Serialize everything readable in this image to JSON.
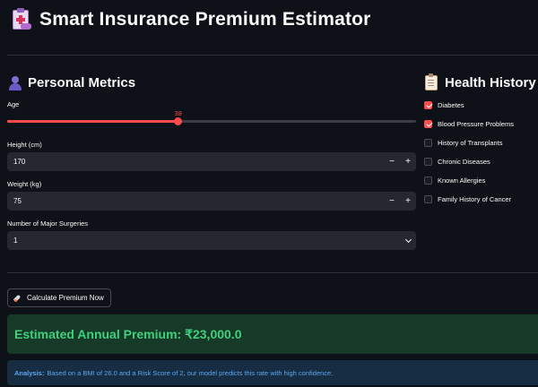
{
  "header": {
    "title": "Smart Insurance Premium Estimator",
    "icon": "clipboard-medical-icon"
  },
  "personal": {
    "heading": "Personal Metrics",
    "icon": "person-icon",
    "age": {
      "label": "Age",
      "value": "38",
      "fraction": 0.418
    },
    "height": {
      "label": "Height (cm)",
      "value": "170"
    },
    "weight": {
      "label": "Weight (kg)",
      "value": "75"
    },
    "surgeries": {
      "label": "Number of Major Surgeries",
      "value": "1"
    }
  },
  "health": {
    "heading": "Health History",
    "icon": "clipboard-icon",
    "items": [
      {
        "label": "Diabetes",
        "checked": true
      },
      {
        "label": "Blood Pressure Problems",
        "checked": true
      },
      {
        "label": "History of Transplants",
        "checked": false
      },
      {
        "label": "Chronic Diseases",
        "checked": false
      },
      {
        "label": "Known Allergies",
        "checked": false
      },
      {
        "label": "Family History of Cancer",
        "checked": false
      }
    ]
  },
  "actions": {
    "calculate_label": "Calculate Premium Now",
    "icon": "rocket-icon"
  },
  "result": {
    "premium_text": "Estimated Annual Premium: ₹23,000.0",
    "analysis_label": "Analysis:",
    "analysis_text": "Based on a BMI of 26.0 and a Risk Score of 2, our model predicts this rate with high confidence."
  },
  "colors": {
    "accent": "#ff4b4b",
    "background": "#0e1117",
    "input_bg": "#262730",
    "success_text": "#3fd07d",
    "info_text": "#5aa7f0"
  },
  "symbols": {
    "minus": "−",
    "plus": "+"
  }
}
